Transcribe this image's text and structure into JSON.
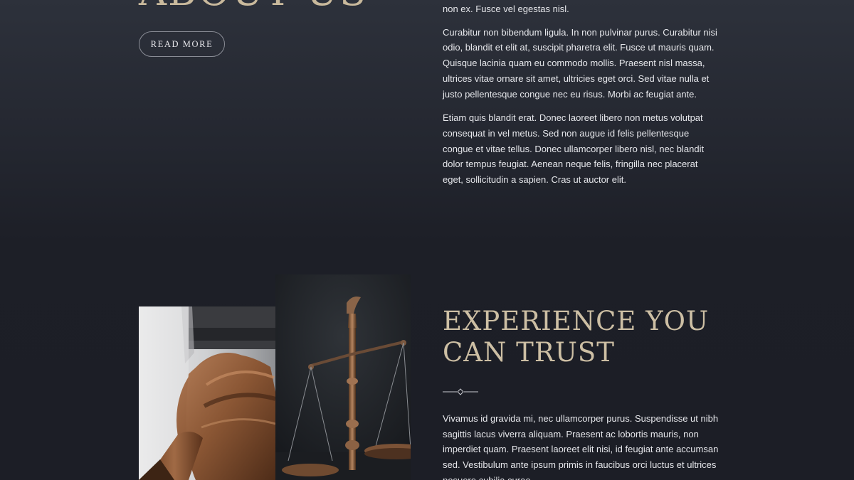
{
  "about": {
    "heading": "ABOUT US",
    "read_more_label": "READ MORE",
    "paragraphs": [
      "non ex. Fusce vel egestas nisl.",
      "Curabitur non bibendum ligula. In non pulvinar purus. Curabitur nisi odio, blandit et elit at, suscipit pharetra elit. Fusce ut mauris quam. Quisque lacinia quam eu commodo mollis. Praesent nisl massa, ultrices vitae ornare sit amet, ultricies eget orci. Sed vitae nulla et justo pellentesque congue nec eu risus. Morbi ac feugiat ante.",
      "Etiam quis blandit erat. Donec laoreet libero non metus volutpat consequat in vel metus. Sed non augue id felis pellentesque congue et vitae tellus. Donec ullamcorper libero nisl, nec blandit dolor tempus feugiat. Aenean neque felis, fringilla nec placerat eget, sollicitudin a sapien. Cras ut auctor elit."
    ]
  },
  "experience": {
    "heading_line1": "EXPERIENCE YOU",
    "heading_line2": "CAN TRUST",
    "text": "Vivamus id gravida mi, nec ullamcorper purus. Suspendisse ut nibh sagittis lacus viverra aliquam. Praesent ac lobortis mauris, non imperdiet quam. Praesent laoreet elit nisi, id feugiat ante accumsan sed. Vestibulum ante ipsum primis in faucibus orci luctus et ultrices posuere cubilia curae."
  },
  "colors": {
    "heading_gold": "#c9b99c",
    "background": "#1c1e26",
    "text": "#e6e7eb"
  }
}
